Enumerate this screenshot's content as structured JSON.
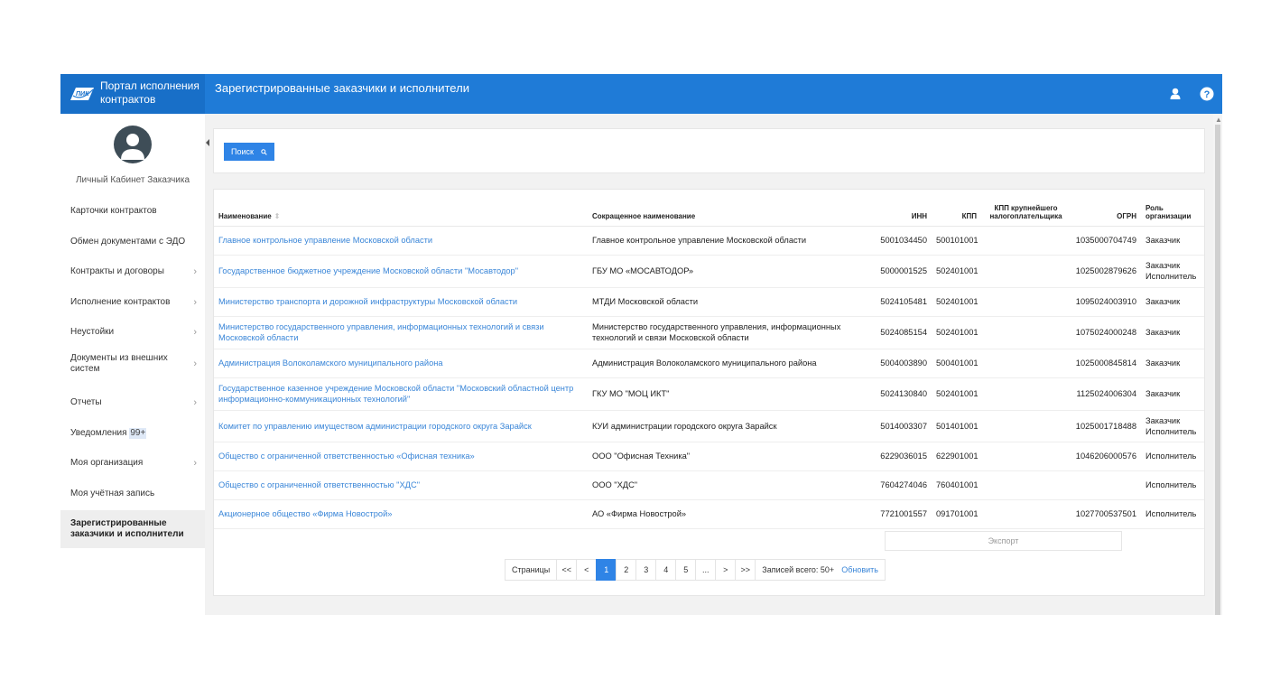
{
  "header": {
    "brand_line1": "Портал исполнения",
    "brand_line2": "контрактов",
    "logo_text": "ПИК",
    "title": "Зарегистрированные заказчики и исполнители",
    "accent_color": "#1f7bd7"
  },
  "sidebar": {
    "cabinet_label": "Личный Кабинет Заказчика",
    "items": [
      {
        "label": "Карточки контрактов",
        "has_submenu": false
      },
      {
        "label": "Обмен документами с ЭДО",
        "has_submenu": false
      },
      {
        "label": "Контракты и договоры",
        "has_submenu": true
      },
      {
        "label": "Исполнение контрактов",
        "has_submenu": true
      },
      {
        "label": "Неустойки",
        "has_submenu": true
      },
      {
        "label": "Документы из внешних систем",
        "has_submenu": true
      },
      {
        "label": "Отчеты",
        "has_submenu": true
      },
      {
        "label": "Уведомления",
        "badge": "99+",
        "has_submenu": false
      },
      {
        "label": "Моя организация",
        "has_submenu": true
      },
      {
        "label": "Моя учётная запись",
        "has_submenu": false
      },
      {
        "label": "Зарегистрированные заказчики и исполнители",
        "has_submenu": false,
        "active": true
      }
    ]
  },
  "search": {
    "button_label": "Поиск"
  },
  "table": {
    "columns": [
      "Наименование",
      "Сокращенное наименование",
      "ИНН",
      "КПП",
      "КПП крупнейшего налогоплательщика",
      "ОГРН",
      "Роль организации"
    ],
    "rows": [
      {
        "name": "Главное контрольное управление Московской области",
        "short": "Главное контрольное управление Московской области",
        "inn": "5001034450",
        "kpp": "500101001",
        "kpp_large": "",
        "ogrn": "1035000704749",
        "role": "Заказчик"
      },
      {
        "name": "Государственное бюджетное учреждение Московской области \"Мосавтодор\"",
        "short": "ГБУ МО «МОСАВТОДОР»",
        "inn": "5000001525",
        "kpp": "502401001",
        "kpp_large": "",
        "ogrn": "1025002879626",
        "role": "Заказчик Исполнитель"
      },
      {
        "name": "Министерство транспорта и дорожной инфраструктуры Московской области",
        "short": "МТДИ Московской области",
        "inn": "5024105481",
        "kpp": "502401001",
        "kpp_large": "",
        "ogrn": "1095024003910",
        "role": "Заказчик"
      },
      {
        "name": "Министерство государственного управления, информационных технологий и связи Московской области",
        "short": "Министерство государственного управления, информационных технологий и связи Московской области",
        "inn": "5024085154",
        "kpp": "502401001",
        "kpp_large": "",
        "ogrn": "1075024000248",
        "role": "Заказчик"
      },
      {
        "name": "Администрация Волоколамского муниципального района",
        "short": "Администрация Волоколамского муниципального района",
        "inn": "5004003890",
        "kpp": "500401001",
        "kpp_large": "",
        "ogrn": "1025000845814",
        "role": "Заказчик"
      },
      {
        "name": "Государственное казенное учреждение Московской области \"Московский областной центр информационно-коммуникационных технологий\"",
        "short": "ГКУ МО \"МОЦ ИКТ\"",
        "inn": "5024130840",
        "kpp": "502401001",
        "kpp_large": "",
        "ogrn": "1125024006304",
        "role": "Заказчик"
      },
      {
        "name": "Комитет по управлению имуществом администрации городского округа Зарайск",
        "short": "КУИ администрации городского округа Зарайск",
        "inn": "5014003307",
        "kpp": "501401001",
        "kpp_large": "",
        "ogrn": "1025001718488",
        "role": "Заказчик Исполнитель"
      },
      {
        "name": "Общество с ограниченной ответственностью «Офисная техника»",
        "short": "ООО \"Офисная Техника\"",
        "inn": "6229036015",
        "kpp": "622901001",
        "kpp_large": "",
        "ogrn": "1046206000576",
        "role": "Исполнитель"
      },
      {
        "name": "Общество с ограниченной ответственностью \"ХДС\"",
        "short": "ООО \"ХДС\"",
        "inn": "7604274046",
        "kpp": "760401001",
        "kpp_large": "",
        "ogrn": "",
        "role": "Исполнитель"
      },
      {
        "name": "Акционерное общество «Фирма Новострой»",
        "short": "АО «Фирма Новострой»",
        "inn": "7721001557",
        "kpp": "091701001",
        "kpp_large": "",
        "ogrn": "1027700537501",
        "role": "Исполнитель"
      }
    ]
  },
  "export_label": "Экспорт",
  "pagination": {
    "label": "Страницы",
    "first": "<<",
    "prev": "<",
    "pages": [
      "1",
      "2",
      "3",
      "4",
      "5",
      "..."
    ],
    "current": "1",
    "next": ">",
    "last": ">>",
    "total": "Записей всего: 50+",
    "refresh": "Обновить"
  }
}
